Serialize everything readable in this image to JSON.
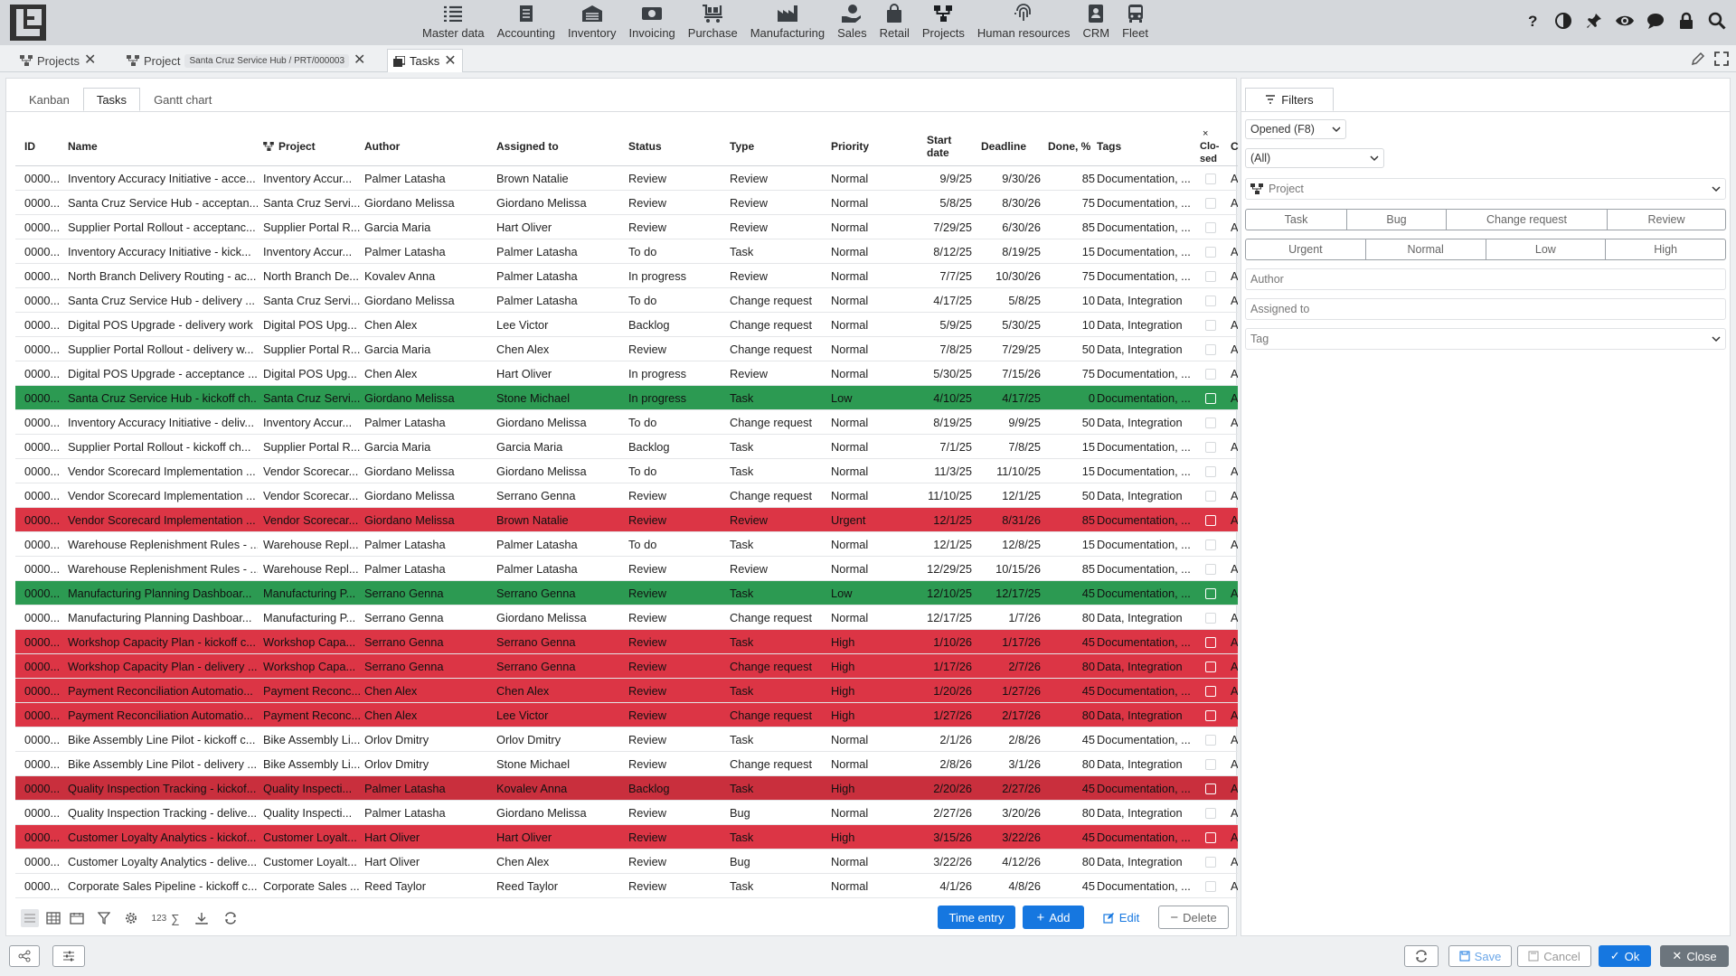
{
  "nav": {
    "modules": [
      {
        "label": "Master data",
        "icon": "list-icon"
      },
      {
        "label": "Accounting",
        "icon": "document-icon"
      },
      {
        "label": "Inventory",
        "icon": "warehouse-icon"
      },
      {
        "label": "Invoicing",
        "icon": "money-icon"
      },
      {
        "label": "Purchase",
        "icon": "cart-icon"
      },
      {
        "label": "Manufacturing",
        "icon": "factory-icon"
      },
      {
        "label": "Sales",
        "icon": "sales-hand-icon"
      },
      {
        "label": "Retail",
        "icon": "shopping-bag-icon"
      },
      {
        "label": "Projects",
        "icon": "sitemap-icon"
      },
      {
        "label": "Human resources",
        "icon": "fingerprint-icon"
      },
      {
        "label": "CRM",
        "icon": "contact-card-icon"
      },
      {
        "label": "Fleet",
        "icon": "bus-icon"
      }
    ]
  },
  "tabs": [
    {
      "label": "Projects"
    },
    {
      "label": "Project",
      "pill": "Santa Cruz Service Hub / PRT/000003"
    },
    {
      "label": "Tasks"
    }
  ],
  "subtabs": [
    "Kanban",
    "Tasks",
    "Gantt chart"
  ],
  "columns": {
    "id": "ID",
    "name": "Name",
    "project": "Project",
    "author": "Author",
    "assigned": "Assigned to",
    "status": "Status",
    "type": "Type",
    "priority": "Priority",
    "start": "Start date",
    "deadline": "Deadline",
    "done": "Done, %",
    "tags": "Tags",
    "closed": "Clo-sed",
    "closed_x": "×",
    "extra": "C"
  },
  "rows": [
    {
      "id": "0000...",
      "name": "Inventory Accuracy Initiative - acce...",
      "project": "Inventory Accur...",
      "author": "Palmer Latasha",
      "assigned": "Brown Natalie",
      "status": "Review",
      "type": "Review",
      "priority": "Normal",
      "start": "9/9/25",
      "deadline": "9/30/26",
      "done": "85",
      "tags": "Documentation, ...",
      "extra": "A",
      "hl": ""
    },
    {
      "id": "0000...",
      "name": "Santa Cruz Service Hub - acceptan...",
      "project": "Santa Cruz Servi...",
      "author": "Giordano Melissa",
      "assigned": "Giordano Melissa",
      "status": "Review",
      "type": "Review",
      "priority": "Normal",
      "start": "5/8/25",
      "deadline": "8/30/26",
      "done": "75",
      "tags": "Documentation, ...",
      "extra": "A",
      "hl": ""
    },
    {
      "id": "0000...",
      "name": "Supplier Portal Rollout - acceptanc...",
      "project": "Supplier Portal R...",
      "author": "Garcia Maria",
      "assigned": "Hart Oliver",
      "status": "Review",
      "type": "Review",
      "priority": "Normal",
      "start": "7/29/25",
      "deadline": "6/30/26",
      "done": "85",
      "tags": "Documentation, ...",
      "extra": "A",
      "hl": ""
    },
    {
      "id": "0000...",
      "name": "Inventory Accuracy Initiative - kick...",
      "project": "Inventory Accur...",
      "author": "Palmer Latasha",
      "assigned": "Palmer Latasha",
      "status": "To do",
      "type": "Task",
      "priority": "Normal",
      "start": "8/12/25",
      "deadline": "8/19/25",
      "done": "15",
      "tags": "Documentation, ...",
      "extra": "A",
      "hl": ""
    },
    {
      "id": "0000...",
      "name": "North Branch Delivery Routing - ac...",
      "project": "North Branch De...",
      "author": "Kovalev Anna",
      "assigned": "Palmer Latasha",
      "status": "In progress",
      "type": "Review",
      "priority": "Normal",
      "start": "7/7/25",
      "deadline": "10/30/26",
      "done": "75",
      "tags": "Documentation, ...",
      "extra": "A",
      "hl": ""
    },
    {
      "id": "0000...",
      "name": "Santa Cruz Service Hub - delivery ...",
      "project": "Santa Cruz Servi...",
      "author": "Giordano Melissa",
      "assigned": "Palmer Latasha",
      "status": "To do",
      "type": "Change request",
      "priority": "Normal",
      "start": "4/17/25",
      "deadline": "5/8/25",
      "done": "10",
      "tags": "Data, Integration",
      "extra": "A",
      "hl": ""
    },
    {
      "id": "0000...",
      "name": "Digital POS Upgrade - delivery work",
      "project": "Digital POS Upg...",
      "author": "Chen Alex",
      "assigned": "Lee Victor",
      "status": "Backlog",
      "type": "Change request",
      "priority": "Normal",
      "start": "5/9/25",
      "deadline": "5/30/25",
      "done": "10",
      "tags": "Data, Integration",
      "extra": "A",
      "hl": ""
    },
    {
      "id": "0000...",
      "name": "Supplier Portal Rollout - delivery w...",
      "project": "Supplier Portal R...",
      "author": "Garcia Maria",
      "assigned": "Chen Alex",
      "status": "Review",
      "type": "Change request",
      "priority": "Normal",
      "start": "7/8/25",
      "deadline": "7/29/25",
      "done": "50",
      "tags": "Data, Integration",
      "extra": "A",
      "hl": ""
    },
    {
      "id": "0000...",
      "name": "Digital POS Upgrade - acceptance ...",
      "project": "Digital POS Upg...",
      "author": "Chen Alex",
      "assigned": "Hart Oliver",
      "status": "In progress",
      "type": "Review",
      "priority": "Normal",
      "start": "5/30/25",
      "deadline": "7/15/26",
      "done": "75",
      "tags": "Documentation, ...",
      "extra": "A",
      "hl": ""
    },
    {
      "id": "0000...",
      "name": "Santa Cruz Service Hub - kickoff ch...",
      "project": "Santa Cruz Servi...",
      "author": "Giordano Melissa",
      "assigned": "Stone Michael",
      "status": "In progress",
      "type": "Task",
      "priority": "Low",
      "start": "4/10/25",
      "deadline": "4/17/25",
      "done": "0",
      "tags": "Documentation, ...",
      "extra": "A",
      "hl": "green"
    },
    {
      "id": "0000...",
      "name": "Inventory Accuracy Initiative - deliv...",
      "project": "Inventory Accur...",
      "author": "Palmer Latasha",
      "assigned": "Giordano Melissa",
      "status": "To do",
      "type": "Change request",
      "priority": "Normal",
      "start": "8/19/25",
      "deadline": "9/9/25",
      "done": "50",
      "tags": "Data, Integration",
      "extra": "A",
      "hl": ""
    },
    {
      "id": "0000...",
      "name": "Supplier Portal Rollout - kickoff ch...",
      "project": "Supplier Portal R...",
      "author": "Garcia Maria",
      "assigned": "Garcia Maria",
      "status": "Backlog",
      "type": "Task",
      "priority": "Normal",
      "start": "7/1/25",
      "deadline": "7/8/25",
      "done": "15",
      "tags": "Documentation, ...",
      "extra": "A",
      "hl": ""
    },
    {
      "id": "0000...",
      "name": "Vendor Scorecard Implementation ...",
      "project": "Vendor Scorecar...",
      "author": "Giordano Melissa",
      "assigned": "Giordano Melissa",
      "status": "To do",
      "type": "Task",
      "priority": "Normal",
      "start": "11/3/25",
      "deadline": "11/10/25",
      "done": "15",
      "tags": "Documentation, ...",
      "extra": "A",
      "hl": ""
    },
    {
      "id": "0000...",
      "name": "Vendor Scorecard Implementation ...",
      "project": "Vendor Scorecar...",
      "author": "Giordano Melissa",
      "assigned": "Serrano Genna",
      "status": "Review",
      "type": "Change request",
      "priority": "Normal",
      "start": "11/10/25",
      "deadline": "12/1/25",
      "done": "50",
      "tags": "Data, Integration",
      "extra": "A",
      "hl": ""
    },
    {
      "id": "0000...",
      "name": "Vendor Scorecard Implementation ...",
      "project": "Vendor Scorecar...",
      "author": "Giordano Melissa",
      "assigned": "Brown Natalie",
      "status": "Review",
      "type": "Review",
      "priority": "Urgent",
      "start": "12/1/25",
      "deadline": "8/31/26",
      "done": "85",
      "tags": "Documentation, ...",
      "extra": "A",
      "hl": "red"
    },
    {
      "id": "0000...",
      "name": "Warehouse Replenishment Rules - ...",
      "project": "Warehouse Repl...",
      "author": "Palmer Latasha",
      "assigned": "Palmer Latasha",
      "status": "To do",
      "type": "Task",
      "priority": "Normal",
      "start": "12/1/25",
      "deadline": "12/8/25",
      "done": "15",
      "tags": "Documentation, ...",
      "extra": "A",
      "hl": ""
    },
    {
      "id": "0000...",
      "name": "Warehouse Replenishment Rules - ...",
      "project": "Warehouse Repl...",
      "author": "Palmer Latasha",
      "assigned": "Palmer Latasha",
      "status": "Review",
      "type": "Review",
      "priority": "Normal",
      "start": "12/29/25",
      "deadline": "10/15/26",
      "done": "85",
      "tags": "Documentation, ...",
      "extra": "A",
      "hl": ""
    },
    {
      "id": "0000...",
      "name": "Manufacturing Planning Dashboar...",
      "project": "Manufacturing P...",
      "author": "Serrano Genna",
      "assigned": "Serrano Genna",
      "status": "Review",
      "type": "Task",
      "priority": "Low",
      "start": "12/10/25",
      "deadline": "12/17/25",
      "done": "45",
      "tags": "Documentation, ...",
      "extra": "A",
      "hl": "green"
    },
    {
      "id": "0000...",
      "name": "Manufacturing Planning Dashboar...",
      "project": "Manufacturing P...",
      "author": "Serrano Genna",
      "assigned": "Giordano Melissa",
      "status": "Review",
      "type": "Change request",
      "priority": "Normal",
      "start": "12/17/25",
      "deadline": "1/7/26",
      "done": "80",
      "tags": "Data, Integration",
      "extra": "A",
      "hl": ""
    },
    {
      "id": "0000...",
      "name": "Workshop Capacity Plan - kickoff c...",
      "project": "Workshop Capa...",
      "author": "Serrano Genna",
      "assigned": "Serrano Genna",
      "status": "Review",
      "type": "Task",
      "priority": "High",
      "start": "1/10/26",
      "deadline": "1/17/26",
      "done": "45",
      "tags": "Documentation, ...",
      "extra": "A",
      "hl": "red"
    },
    {
      "id": "0000...",
      "name": "Workshop Capacity Plan - delivery ...",
      "project": "Workshop Capa...",
      "author": "Serrano Genna",
      "assigned": "Serrano Genna",
      "status": "Review",
      "type": "Change request",
      "priority": "High",
      "start": "1/17/26",
      "deadline": "2/7/26",
      "done": "80",
      "tags": "Data, Integration",
      "extra": "A",
      "hl": "red"
    },
    {
      "id": "0000...",
      "name": "Payment Reconciliation Automatio...",
      "project": "Payment Reconc...",
      "author": "Chen Alex",
      "assigned": "Chen Alex",
      "status": "Review",
      "type": "Task",
      "priority": "High",
      "start": "1/20/26",
      "deadline": "1/27/26",
      "done": "45",
      "tags": "Documentation, ...",
      "extra": "A",
      "hl": "red"
    },
    {
      "id": "0000...",
      "name": "Payment Reconciliation Automatio...",
      "project": "Payment Reconc...",
      "author": "Chen Alex",
      "assigned": "Lee Victor",
      "status": "Review",
      "type": "Change request",
      "priority": "High",
      "start": "1/27/26",
      "deadline": "2/17/26",
      "done": "80",
      "tags": "Data, Integration",
      "extra": "A",
      "hl": "red"
    },
    {
      "id": "0000...",
      "name": "Bike Assembly Line Pilot - kickoff c...",
      "project": "Bike Assembly Li...",
      "author": "Orlov Dmitry",
      "assigned": "Orlov Dmitry",
      "status": "Review",
      "type": "Task",
      "priority": "Normal",
      "start": "2/1/26",
      "deadline": "2/8/26",
      "done": "45",
      "tags": "Documentation, ...",
      "extra": "A",
      "hl": ""
    },
    {
      "id": "0000...",
      "name": "Bike Assembly Line Pilot - delivery ...",
      "project": "Bike Assembly Li...",
      "author": "Orlov Dmitry",
      "assigned": "Stone Michael",
      "status": "Review",
      "type": "Change request",
      "priority": "Normal",
      "start": "2/8/26",
      "deadline": "3/1/26",
      "done": "80",
      "tags": "Data, Integration",
      "extra": "A",
      "hl": ""
    },
    {
      "id": "0000...",
      "name": "Quality Inspection Tracking - kickof...",
      "project": "Quality Inspecti...",
      "author": "Palmer Latasha",
      "assigned": "Kovalev Anna",
      "status": "Backlog",
      "type": "Task",
      "priority": "High",
      "start": "2/20/26",
      "deadline": "2/27/26",
      "done": "45",
      "tags": "Documentation, ...",
      "extra": "A",
      "hl": "dred"
    },
    {
      "id": "0000...",
      "name": "Quality Inspection Tracking - delive...",
      "project": "Quality Inspecti...",
      "author": "Palmer Latasha",
      "assigned": "Giordano Melissa",
      "status": "Review",
      "type": "Bug",
      "priority": "Normal",
      "start": "2/27/26",
      "deadline": "3/20/26",
      "done": "80",
      "tags": "Data, Integration",
      "extra": "A",
      "hl": ""
    },
    {
      "id": "0000...",
      "name": "Customer Loyalty Analytics - kickof...",
      "project": "Customer Loyalt...",
      "author": "Hart Oliver",
      "assigned": "Hart Oliver",
      "status": "Review",
      "type": "Task",
      "priority": "High",
      "start": "3/15/26",
      "deadline": "3/22/26",
      "done": "45",
      "tags": "Documentation, ...",
      "extra": "A",
      "hl": "red"
    },
    {
      "id": "0000...",
      "name": "Customer Loyalty Analytics - delive...",
      "project": "Customer Loyalt...",
      "author": "Hart Oliver",
      "assigned": "Chen Alex",
      "status": "Review",
      "type": "Bug",
      "priority": "Normal",
      "start": "3/22/26",
      "deadline": "4/12/26",
      "done": "80",
      "tags": "Data, Integration",
      "extra": "A",
      "hl": ""
    },
    {
      "id": "0000...",
      "name": "Corporate Sales Pipeline - kickoff c...",
      "project": "Corporate Sales ...",
      "author": "Reed Taylor",
      "assigned": "Reed Taylor",
      "status": "Review",
      "type": "Task",
      "priority": "Normal",
      "start": "4/1/26",
      "deadline": "4/8/26",
      "done": "45",
      "tags": "Documentation, ...",
      "extra": "A",
      "hl": ""
    }
  ],
  "toolbar": {
    "counter": "123",
    "sigma": "∑",
    "time_entry": "Time entry",
    "add": "Add",
    "edit": "Edit",
    "delete": "Delete"
  },
  "filters": {
    "title": "Filters",
    "state": "Opened (F8)",
    "scope": "(All)",
    "project_placeholder": "Project",
    "types": [
      "Task",
      "Bug",
      "Change request",
      "Review"
    ],
    "priorities": [
      "Urgent",
      "Normal",
      "Low",
      "High"
    ],
    "author_placeholder": "Author",
    "assigned_placeholder": "Assigned to",
    "tag_placeholder": "Tag"
  },
  "footer": {
    "save": "Save",
    "cancel": "Cancel",
    "ok": "Ok",
    "close": "Close"
  },
  "colors": {
    "accent": "#1677e0",
    "row_green": "#2c9a52",
    "row_red": "#dc3545",
    "row_dark_red": "#c92f3d"
  }
}
